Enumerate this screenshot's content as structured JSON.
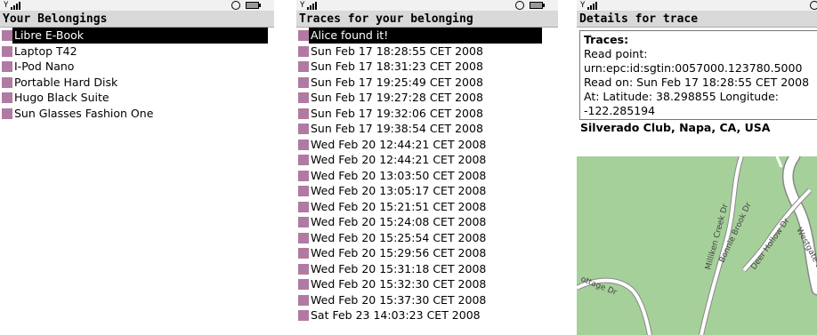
{
  "screens": [
    {
      "title": "Your Belongings",
      "items": [
        {
          "label": "Libre E-Book",
          "selected": true
        },
        {
          "label": "Laptop T42",
          "selected": false
        },
        {
          "label": "I-Pod Nano",
          "selected": false
        },
        {
          "label": "Portable Hard Disk",
          "selected": false
        },
        {
          "label": "Hugo Black Suite",
          "selected": false
        },
        {
          "label": "Sun Glasses Fashion One",
          "selected": false
        }
      ]
    },
    {
      "title": "Traces for your belonging",
      "items": [
        {
          "label": "Alice found it!",
          "selected": true
        },
        {
          "label": "Sun Feb 17 18:28:55 CET 2008"
        },
        {
          "label": "Sun Feb 17 18:31:23 CET 2008"
        },
        {
          "label": "Sun Feb 17 19:25:49 CET 2008"
        },
        {
          "label": "Sun Feb 17 19:27:28 CET 2008"
        },
        {
          "label": "Sun Feb 17 19:32:06 CET 2008"
        },
        {
          "label": "Sun Feb 17 19:38:54 CET 2008"
        },
        {
          "label": "Wed Feb 20 12:44:21 CET 2008"
        },
        {
          "label": "Wed Feb 20 12:44:21 CET 2008"
        },
        {
          "label": "Wed Feb 20 13:03:50 CET 2008"
        },
        {
          "label": "Wed Feb 20 13:05:17 CET 2008"
        },
        {
          "label": "Wed Feb 20 15:21:51 CET 2008"
        },
        {
          "label": "Wed Feb 20 15:24:08 CET 2008"
        },
        {
          "label": "Wed Feb 20 15:25:54 CET 2008"
        },
        {
          "label": "Wed Feb 20 15:29:56 CET 2008"
        },
        {
          "label": "Wed Feb 20 15:31:18 CET 2008"
        },
        {
          "label": "Wed Feb 20 15:32:30 CET 2008"
        },
        {
          "label": "Wed Feb 20 15:37:30 CET 2008"
        },
        {
          "label": "Sat Feb 23 14:03:23 CET 2008"
        }
      ]
    },
    {
      "title": "Details for trace",
      "details": {
        "header": "Traces:",
        "line1": "Read point:",
        "line2": "urn:epc:id:sgtin:0057000.123780.5000",
        "line3": "Read on: Sun Feb 17 18:28:55 CET 2008",
        "line4": "At: Latitude: 38.298855 Longitude:",
        "line5": "-122.285194"
      },
      "map_title": "Silverado Club, Napa, CA, USA",
      "map_streets": [
        "Milliken Creek Dr",
        "Bonnie Brook Dr",
        "Deer Hollow Dr",
        "Westgate Dr",
        "ottage Dr"
      ]
    }
  ],
  "colors": {
    "item_square": "#b07aa3",
    "map_green": "#a6d09a",
    "map_road": "#ffffff",
    "title_bg": "#d9d9d9"
  },
  "icons": {
    "signal": "signal-strength-icon",
    "clock": "clock-icon",
    "battery": "battery-icon"
  }
}
